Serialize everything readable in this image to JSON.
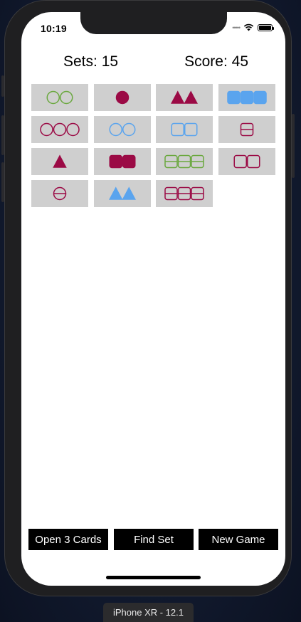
{
  "status_bar": {
    "time": "10:19"
  },
  "header": {
    "sets_label": "Sets: 15",
    "score_label": "Score: 45"
  },
  "colors": {
    "green": "#6aa83e",
    "maroon": "#9b0a45",
    "blue": "#5aa4ee",
    "card_bg": "#cfcfcf"
  },
  "cards": [
    {
      "count": 2,
      "shape": "circle",
      "fill": "open",
      "color": "green"
    },
    {
      "count": 1,
      "shape": "circle",
      "fill": "solid",
      "color": "maroon"
    },
    {
      "count": 2,
      "shape": "triangle",
      "fill": "solid",
      "color": "maroon"
    },
    {
      "count": 3,
      "shape": "square",
      "fill": "solid",
      "color": "blue"
    },
    {
      "count": 3,
      "shape": "circle",
      "fill": "open",
      "color": "maroon"
    },
    {
      "count": 2,
      "shape": "circle",
      "fill": "open",
      "color": "blue"
    },
    {
      "count": 2,
      "shape": "square",
      "fill": "open",
      "color": "blue"
    },
    {
      "count": 1,
      "shape": "square",
      "fill": "striped",
      "color": "maroon"
    },
    {
      "count": 1,
      "shape": "triangle",
      "fill": "solid",
      "color": "maroon"
    },
    {
      "count": 2,
      "shape": "square",
      "fill": "solid",
      "color": "maroon"
    },
    {
      "count": 3,
      "shape": "square",
      "fill": "striped",
      "color": "green"
    },
    {
      "count": 2,
      "shape": "square",
      "fill": "open",
      "color": "maroon"
    },
    {
      "count": 1,
      "shape": "circle",
      "fill": "striped",
      "color": "maroon"
    },
    {
      "count": 2,
      "shape": "triangle",
      "fill": "solid",
      "color": "blue"
    },
    {
      "count": 3,
      "shape": "square",
      "fill": "striped",
      "color": "maroon"
    }
  ],
  "actions": {
    "open_cards": "Open 3 Cards",
    "find_set": "Find Set",
    "new_game": "New Game"
  },
  "simulator": {
    "device_label": "iPhone XR - 12.1"
  }
}
